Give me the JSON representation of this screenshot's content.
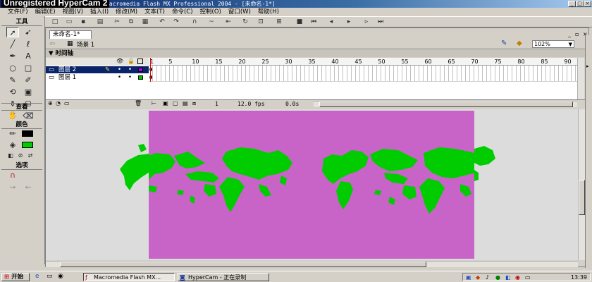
{
  "watermark": "Unregistered HyperCam 2",
  "window_title": "Macromedia Flash MX Professional 2004 - [未命名-1*]",
  "menu": [
    "文件(F)",
    "编辑(E)",
    "视图(V)",
    "插入(I)",
    "修改(M)",
    "文本(T)",
    "命令(C)",
    "控制(O)",
    "窗口(W)",
    "帮助(H)"
  ],
  "tools": {
    "header": "工具",
    "view_header": "查看",
    "colors_header": "颜色",
    "options_header": "选项"
  },
  "document": {
    "tab_label": "未命名-1*",
    "scene_label": "场景 1",
    "zoom": "102%"
  },
  "timeline": {
    "header": "时间轴",
    "ruler_ticks": [
      "1",
      "5",
      "10",
      "15",
      "20",
      "25",
      "30",
      "35",
      "40",
      "45",
      "50",
      "55",
      "60",
      "65",
      "70",
      "75",
      "80",
      "85",
      "90"
    ],
    "layers": [
      {
        "name": "图层 2",
        "selected": true,
        "color": "#b200ff"
      },
      {
        "name": "图层 1",
        "selected": false,
        "color": "#00c000"
      }
    ],
    "current_frame": "1",
    "fps": "12.0 fps",
    "elapsed": "0.0s"
  },
  "stage": {
    "background_color": "#c864c8",
    "map_color": "#00cc00"
  },
  "taskbar": {
    "start_label": "开始",
    "tasks": [
      {
        "label": "Macromedia Flash MX...",
        "active": true
      },
      {
        "label": "HyperCam - 正在录制",
        "active": false
      }
    ],
    "clock": "13:39"
  }
}
